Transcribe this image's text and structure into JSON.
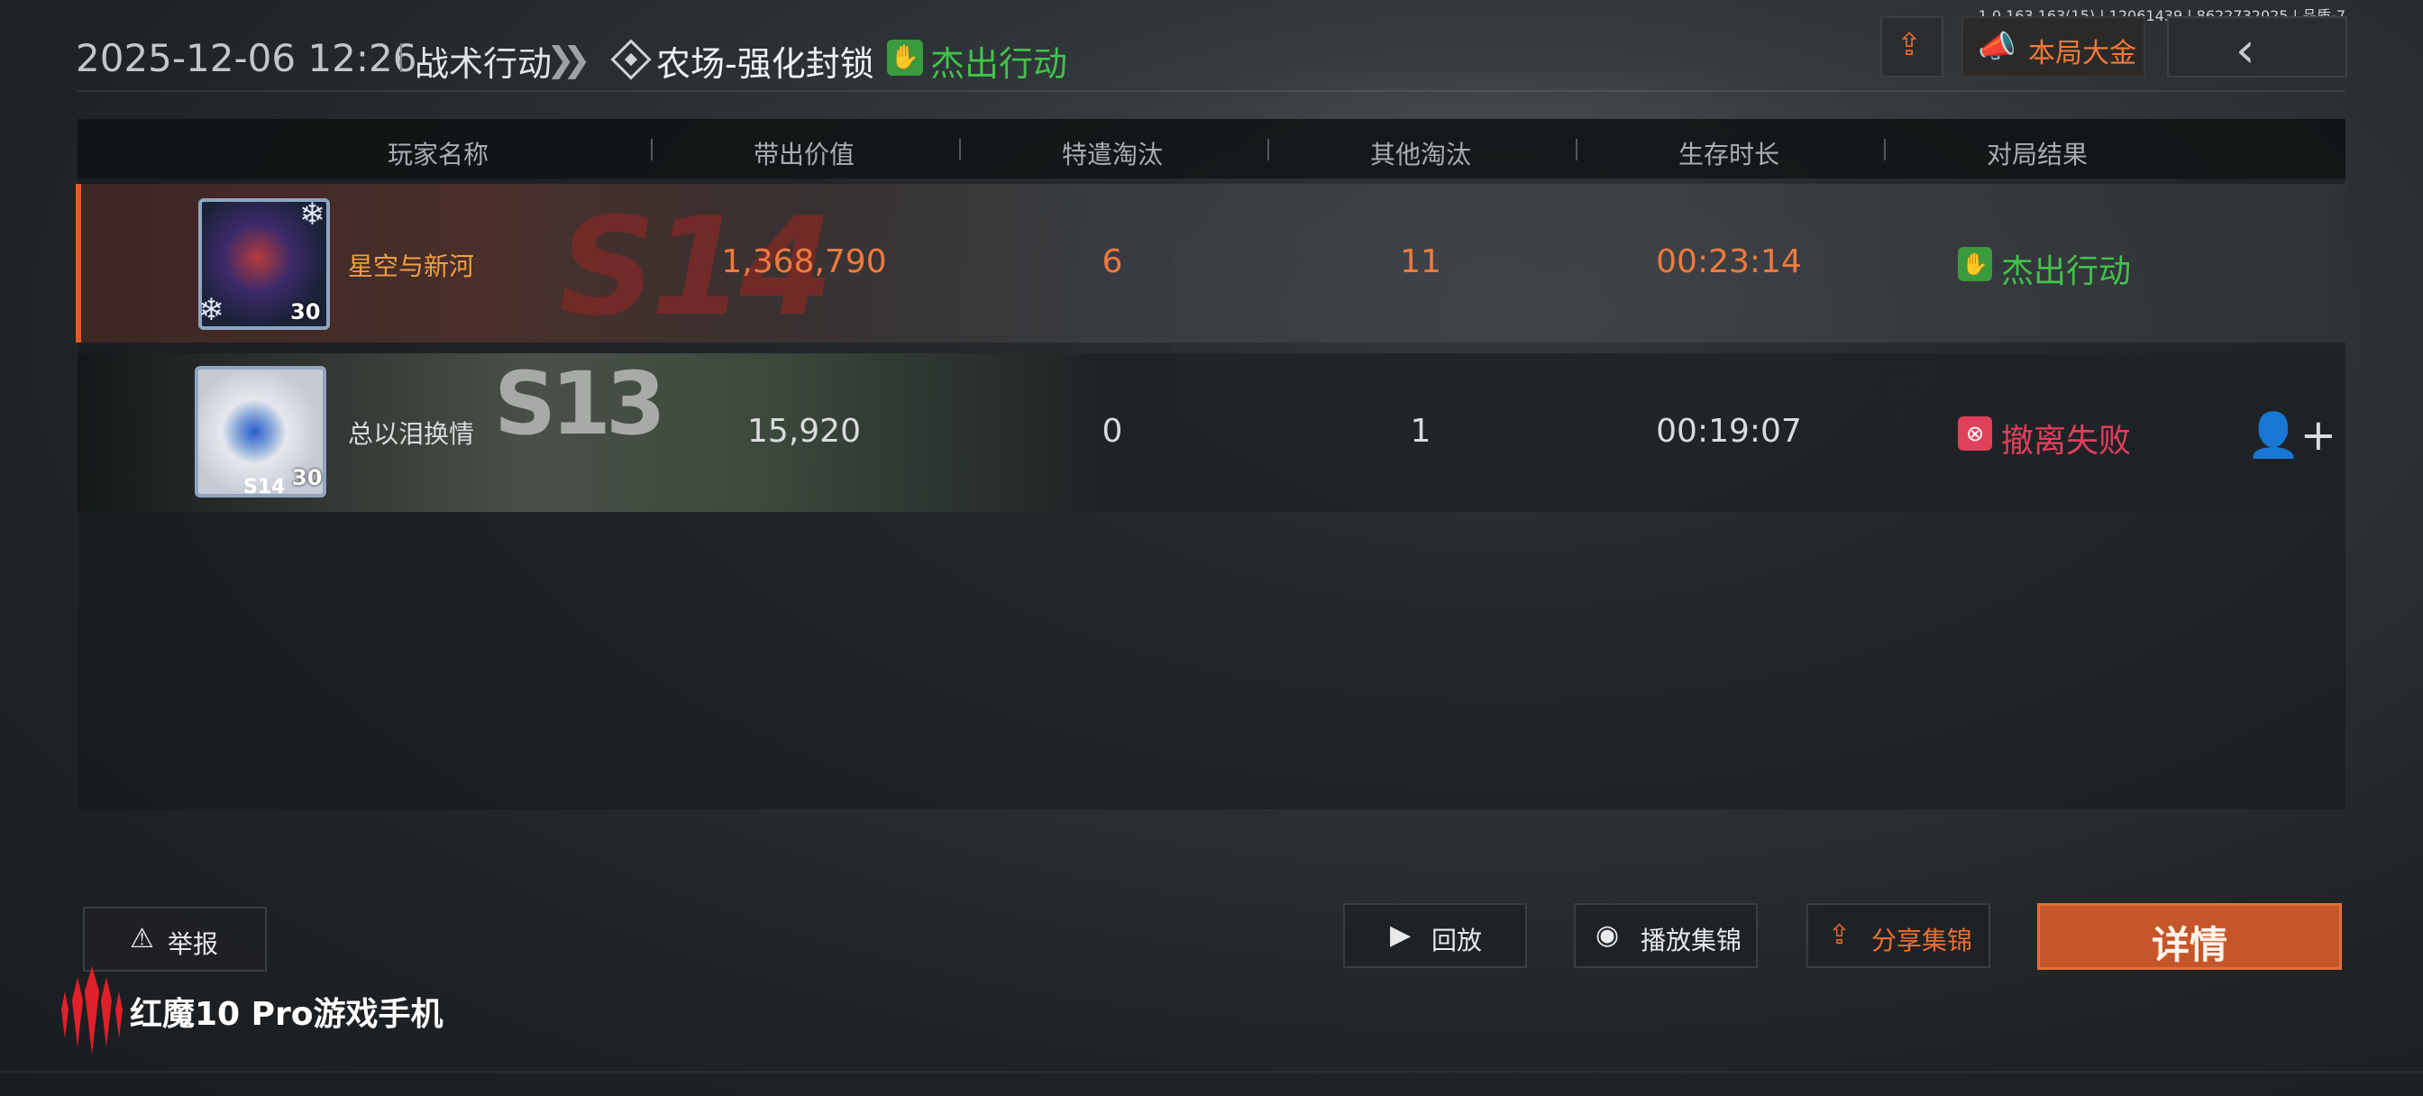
{
  "server_info": "1.0.163.163(15) | 12061439 | 8622732025 | 品质-7",
  "header": {
    "datetime": "2025-12-06 12:26",
    "mode": "战术行动",
    "map": "农场-强化封锁",
    "result": "杰出行动",
    "jackpot_label": "本局大金"
  },
  "table": {
    "columns": [
      "玩家名称",
      "带出价值",
      "特遣淘汰",
      "其他淘汰",
      "生存时长",
      "对局结果"
    ],
    "rows": [
      {
        "player_name": "星空与新河",
        "level": "30",
        "season_bg": "S14",
        "value": "1,368,790",
        "special_kills": "6",
        "other_kills": "11",
        "survival_time": "00:23:14",
        "result": "杰出行动",
        "result_color": "#42c24a"
      },
      {
        "player_name": "总以泪换情",
        "level": "30",
        "season_badge": "S14",
        "season_bg": "S13",
        "value": "15,920",
        "special_kills": "0",
        "other_kills": "1",
        "survival_time": "00:19:07",
        "result": "撤离失败",
        "result_color": "#e0405a"
      }
    ]
  },
  "bottom": {
    "report_label": "举报",
    "replay_label": "回放",
    "highlights_label": "播放集锦",
    "share_highlights_label": "分享集锦",
    "details_label": "详情"
  },
  "brand": {
    "text": "红魔10 Pro游戏手机"
  },
  "colors": {
    "accent_orange": "#e65a24",
    "success_green": "#42c24a",
    "fail_red": "#e0405a",
    "details_button": "#c5562a"
  },
  "icons": [
    "share-icon",
    "megaphone-icon",
    "back-chevron-icon",
    "diamond-map-icon",
    "success-badge-icon",
    "fail-badge-icon",
    "add-friend-icon",
    "warning-icon",
    "replay-icon",
    "highlights-icon"
  ]
}
